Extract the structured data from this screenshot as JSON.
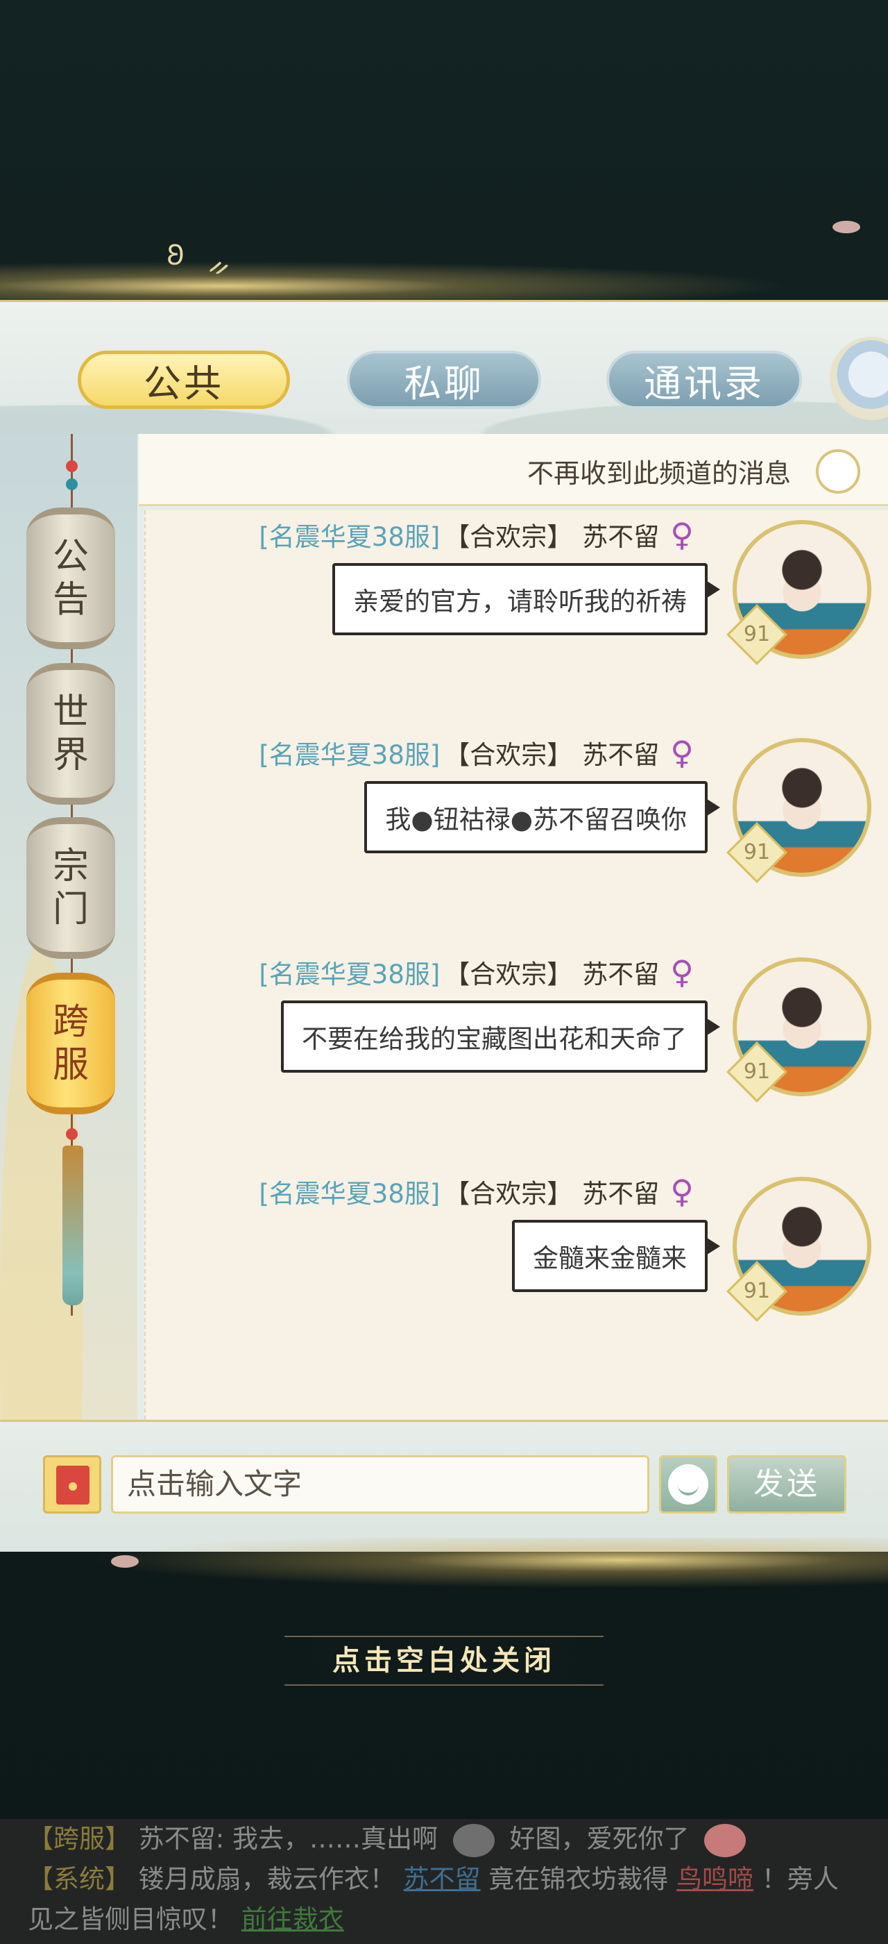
{
  "tabs": [
    {
      "label": "公共",
      "active": true
    },
    {
      "label": "私聊",
      "active": false
    },
    {
      "label": "通讯录",
      "active": false
    }
  ],
  "channels": [
    {
      "label": "公告",
      "active": false
    },
    {
      "label": "世界",
      "active": false
    },
    {
      "label": "宗门",
      "active": false
    },
    {
      "label": "跨服",
      "active": true
    }
  ],
  "mute_label": "不再收到此频道的消息",
  "messages": [
    {
      "server": "[名震华夏38服]",
      "sect": "【合欢宗】",
      "name": "苏不留",
      "gender": "♀",
      "text": "亲爱的官方，请聆听我的祈祷",
      "level": "91"
    },
    {
      "server": "[名震华夏38服]",
      "sect": "【合欢宗】",
      "name": "苏不留",
      "gender": "♀",
      "text": "我●钮祜禄●苏不留召唤你",
      "level": "91"
    },
    {
      "server": "[名震华夏38服]",
      "sect": "【合欢宗】",
      "name": "苏不留",
      "gender": "♀",
      "text": "不要在给我的宝藏图出花和天命了",
      "level": "91"
    },
    {
      "server": "[名震华夏38服]",
      "sect": "【合欢宗】",
      "name": "苏不留",
      "gender": "♀",
      "text": "金髓来金髓来",
      "level": "91"
    }
  ],
  "input": {
    "placeholder": "点击输入文字",
    "send_label": "发送"
  },
  "close_hint": "点击空白处关闭",
  "ticker": {
    "line1": {
      "tag": "【跨服】",
      "text_a": "苏不留: 我去，……真出啊",
      "text_b": "好图，爱死你了"
    },
    "line2": {
      "tag": "【系统】",
      "text_a": "镂月成扇，裁云作衣！",
      "link_user": "苏不留",
      "text_b": "竟在锦衣坊裁得",
      "link_item": "鸟鸣啼",
      "text_c": "！旁人见之皆侧目惊叹！",
      "link_go": "前往裁衣"
    }
  },
  "colors": {
    "server": "#5aa3b7",
    "female": "#a54fb8",
    "tab_active": "#f6d96a",
    "tab_inactive": "#7c9fb0"
  }
}
